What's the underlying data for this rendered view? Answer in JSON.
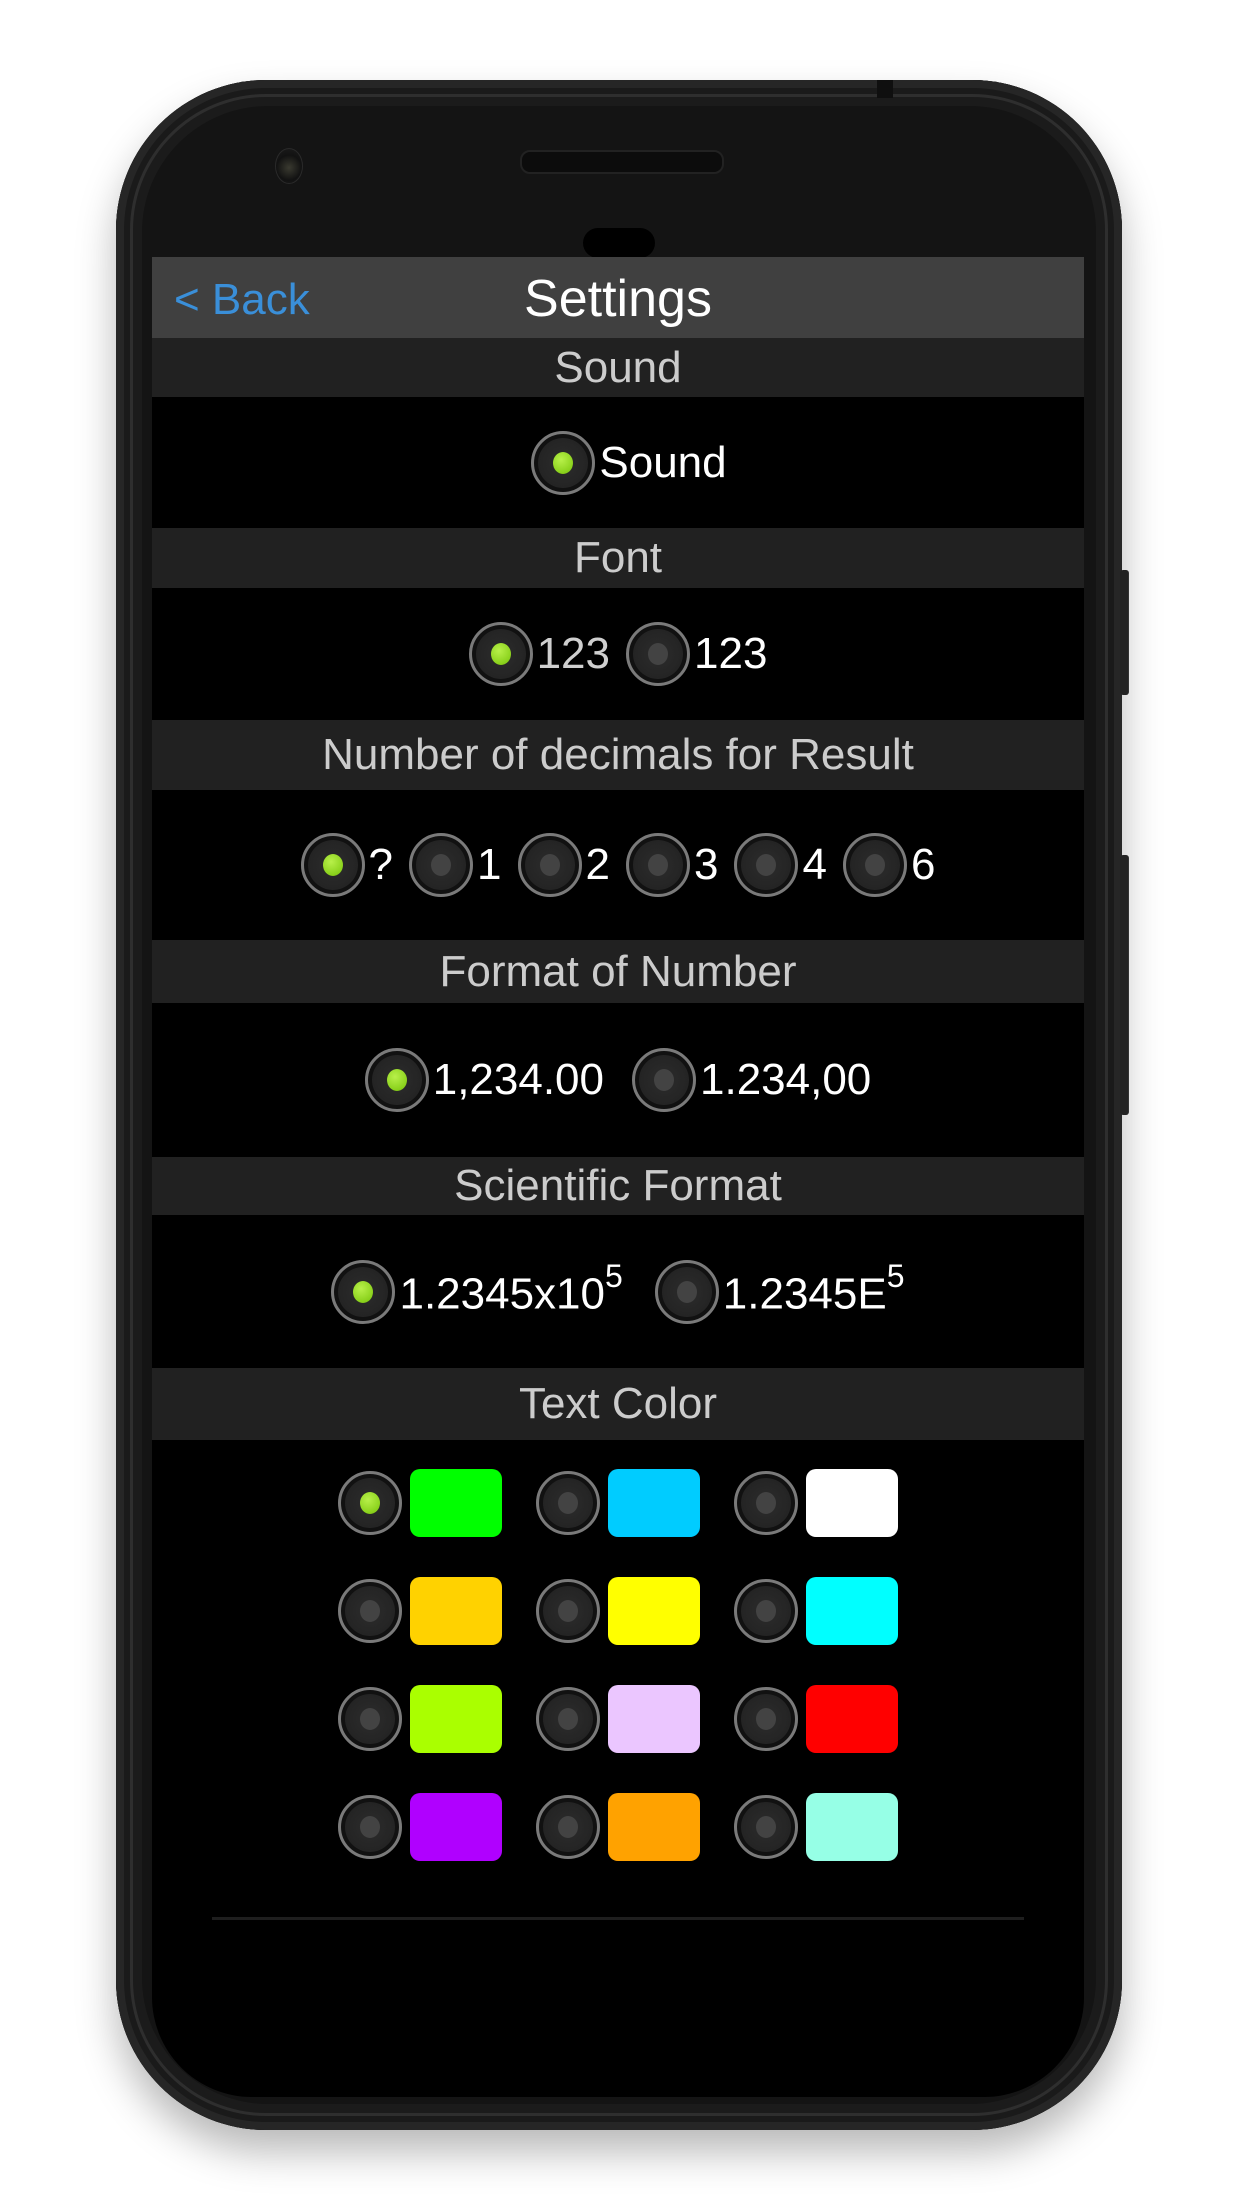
{
  "nav": {
    "back_label": "< Back",
    "title": "Settings"
  },
  "sections": {
    "sound": {
      "header": "Sound",
      "options": [
        {
          "label": "Sound",
          "selected": true
        }
      ]
    },
    "font": {
      "header": "Font",
      "options": [
        {
          "label": "123",
          "selected": true,
          "style": "thin"
        },
        {
          "label": "123",
          "selected": false,
          "style": "regular"
        }
      ]
    },
    "decimals": {
      "header": "Number of decimals for Result",
      "options": [
        {
          "label": "?",
          "selected": true
        },
        {
          "label": "1",
          "selected": false
        },
        {
          "label": "2",
          "selected": false
        },
        {
          "label": "3",
          "selected": false
        },
        {
          "label": "4",
          "selected": false
        },
        {
          "label": "6",
          "selected": false
        }
      ]
    },
    "number_format": {
      "header": "Format of Number",
      "options": [
        {
          "label": "1,234.00",
          "selected": true
        },
        {
          "label": "1.234,00",
          "selected": false
        }
      ]
    },
    "scientific": {
      "header": "Scientific Format",
      "options": [
        {
          "base": "1.2345x10",
          "exponent": "5",
          "selected": true
        },
        {
          "base": "1.2345E",
          "exponent": "5",
          "selected": false
        }
      ]
    },
    "text_color": {
      "header": "Text Color",
      "colors": [
        {
          "hex": "#00FF00",
          "selected": true
        },
        {
          "hex": "#00CCFF",
          "selected": false
        },
        {
          "hex": "#FFFFFF",
          "selected": false
        },
        {
          "hex": "#FFD200",
          "selected": false
        },
        {
          "hex": "#FFFF00",
          "selected": false
        },
        {
          "hex": "#00FFFF",
          "selected": false
        },
        {
          "hex": "#AAFF00",
          "selected": false
        },
        {
          "hex": "#EBC6FF",
          "selected": false
        },
        {
          "hex": "#FF0000",
          "selected": false
        },
        {
          "hex": "#B000FF",
          "selected": false
        },
        {
          "hex": "#FFA200",
          "selected": false
        },
        {
          "hex": "#96FFE6",
          "selected": false
        }
      ]
    }
  },
  "colors": {
    "accent_link": "#3A8FD9",
    "radio_selected": "#8AD11C",
    "nav_bg": "#404040",
    "section_bg": "#212121"
  }
}
